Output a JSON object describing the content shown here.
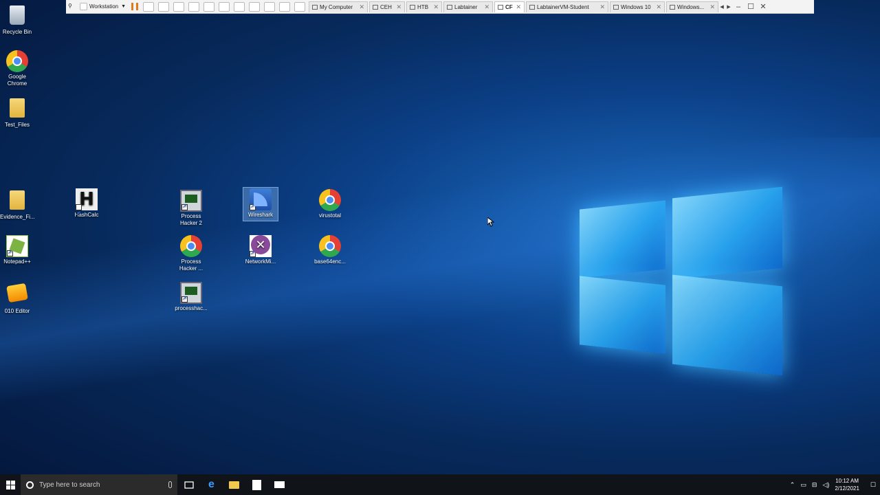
{
  "vmware": {
    "menu_label": "Workstation",
    "tabs": [
      {
        "label": "My Computer",
        "active": false
      },
      {
        "label": "CEH",
        "active": false
      },
      {
        "label": "HTB",
        "active": false
      },
      {
        "label": "Labtainer",
        "active": false
      },
      {
        "label": "CF",
        "active": true
      },
      {
        "label": "LabtainerVM-Student",
        "active": false
      },
      {
        "label": "Windows 10",
        "active": false
      },
      {
        "label": "Windows...",
        "active": false
      }
    ]
  },
  "desktop": {
    "icons": [
      {
        "label": "Recycle Bin",
        "icon": "recycle-bin-icon"
      },
      {
        "label": "Google Chrome",
        "icon": "chrome-icon"
      },
      {
        "label": "Test_Files",
        "icon": "folder-icon"
      },
      {
        "label": "Evidence_Fi...",
        "icon": "folder-icon"
      },
      {
        "label": "HashCalc",
        "icon": "hashcalc-icon"
      },
      {
        "label": "Process Hacker 2",
        "icon": "process-hacker-icon"
      },
      {
        "label": "Wireshark",
        "icon": "wireshark-icon",
        "selected": true
      },
      {
        "label": "virustotal",
        "icon": "chrome-icon"
      },
      {
        "label": "Notepad++",
        "icon": "notepad-plus-plus-icon"
      },
      {
        "label": "Process Hacker ...",
        "icon": "chrome-icon"
      },
      {
        "label": "NetworkMi...",
        "icon": "networkminer-icon"
      },
      {
        "label": "base64enc...",
        "icon": "chrome-icon"
      },
      {
        "label": "010 Editor",
        "icon": "010-editor-icon"
      },
      {
        "label": "processhac...",
        "icon": "process-hacker-icon"
      }
    ],
    "hashcalc_glyph": "H"
  },
  "taskbar": {
    "search_placeholder": "Type here to search",
    "time": "10:12 AM",
    "date": "2/12/2021"
  }
}
